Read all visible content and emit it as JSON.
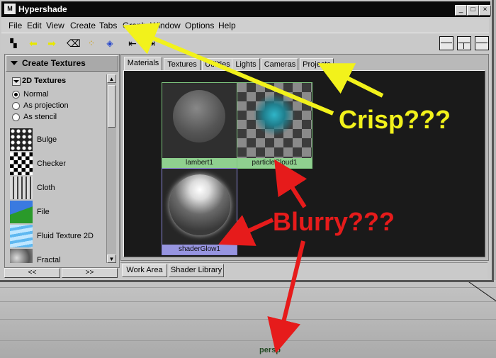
{
  "window": {
    "title": "Hypershade",
    "app_icon": "maya-logo-icon",
    "controls": [
      "_",
      "□",
      "×"
    ]
  },
  "menubar": [
    "File",
    "Edit",
    "View",
    "Create",
    "Tabs",
    "Graph",
    "Window",
    "Options",
    "Help"
  ],
  "create_panel": {
    "header": "Create Textures",
    "section": "2D Textures",
    "projection_options": [
      {
        "label": "Normal",
        "selected": true
      },
      {
        "label": "As projection",
        "selected": false
      },
      {
        "label": "As stencil",
        "selected": false
      }
    ],
    "textures": [
      "Bulge",
      "Checker",
      "Cloth",
      "File",
      "Fluid Texture 2D",
      "Fractal"
    ],
    "bottom_buttons": [
      "<<",
      ">>"
    ]
  },
  "top_tabs": [
    "Materials",
    "Textures",
    "Utilities",
    "Lights",
    "Cameras",
    "Projects"
  ],
  "nodes": [
    "lambert1",
    "particleCloud1",
    "shaderGlow1"
  ],
  "bottom_tabs": [
    "Work Area",
    "Shader Library"
  ],
  "viewport": {
    "label": "persp"
  },
  "annotations": {
    "crisp": "Crisp???",
    "blurry": "Blurry???"
  },
  "colors": {
    "crisp": "#f2f21b",
    "blurry": "#e61b1b",
    "node_border": "#7ec57e",
    "glow_node": "#9795e0"
  }
}
